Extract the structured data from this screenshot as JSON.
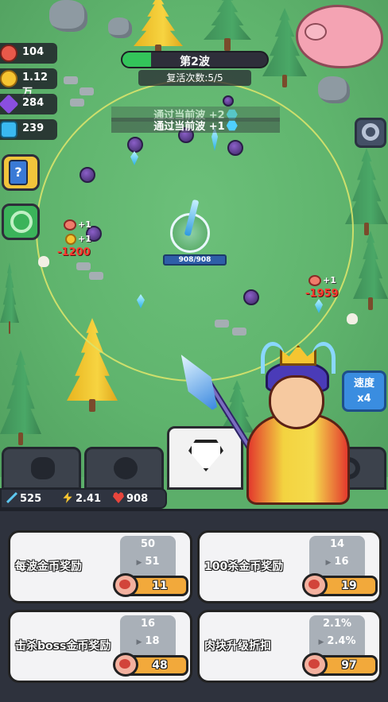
{
  "resources": [
    {
      "name": "meat",
      "value": "104",
      "color": "#e8594a"
    },
    {
      "name": "gold",
      "value": "1.12万",
      "color": "#f6c431"
    },
    {
      "name": "purple-gem",
      "value": "284",
      "color": "#8a4ee0"
    },
    {
      "name": "blue-gem",
      "value": "239",
      "color": "#3ab8f0"
    }
  ],
  "wave": {
    "title": "第2波",
    "progress": 0.2,
    "revive": "复活次数:5/5"
  },
  "toasts": [
    {
      "text": "通过当前波 +2"
    },
    {
      "text": "通过当前波 +1"
    }
  ],
  "hero": {
    "hp": "908/908"
  },
  "floaters": {
    "left_plus_meat": "+1",
    "left_plus_coin": "+1",
    "left_dmg": "-1200",
    "right_plus_meat": "+1",
    "right_dmg": "-1959"
  },
  "speed": {
    "line1": "速度",
    "line2": "x4"
  },
  "stats": {
    "attack": "525",
    "speed": "2.41",
    "hp": "908"
  },
  "cards": [
    {
      "label": "每波金币奖励",
      "current": "50",
      "next": "51",
      "cost": "11"
    },
    {
      "label": "100杀金币奖励",
      "current": "14",
      "next": "16",
      "cost": "19"
    },
    {
      "label": "击杀boss金币奖励",
      "current": "16",
      "next": "18",
      "cost": "48"
    },
    {
      "label": "肉块升级折扣",
      "current": "2.1%",
      "next": "2.4%",
      "cost": "97"
    }
  ],
  "colors": {
    "panel": "#2e323d",
    "card": "#f3f3f5",
    "cost": "#f2a93b",
    "accent_green": "#33c45a",
    "speed": "#3a8de0"
  }
}
